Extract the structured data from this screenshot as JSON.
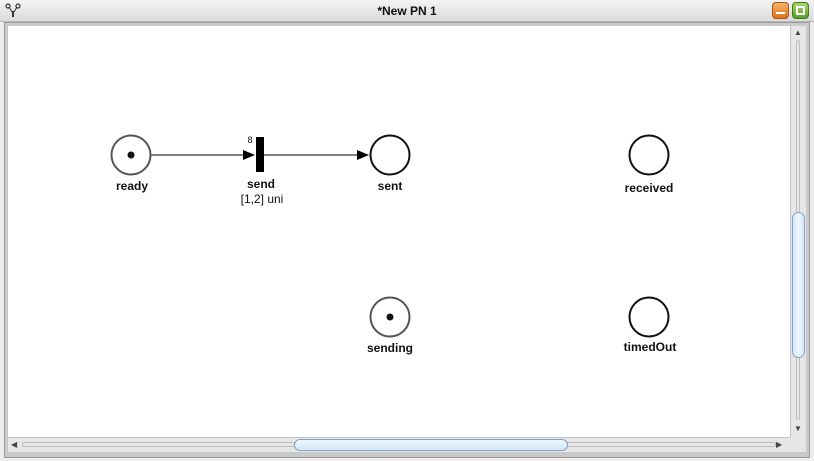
{
  "window": {
    "title": "*New PN 1"
  },
  "net": {
    "places": [
      {
        "id": "ready",
        "label": "ready",
        "tokens": 1
      },
      {
        "id": "sent",
        "label": "sent",
        "tokens": 0
      },
      {
        "id": "received",
        "label": "received",
        "tokens": 0
      },
      {
        "id": "sending",
        "label": "sending",
        "tokens": 1
      },
      {
        "id": "timedOut",
        "label": "timedOut",
        "tokens": 0
      }
    ],
    "transitions": [
      {
        "id": "send",
        "label": "send",
        "timing": "[1,2] uni",
        "priority": "8"
      }
    ],
    "arcs": [
      {
        "from": "ready",
        "to": "send"
      },
      {
        "from": "send",
        "to": "sent"
      }
    ]
  },
  "colors": {
    "titlebar": "#dadada",
    "canvas": "#ffffff",
    "minimize_button": "#e98a2f",
    "maximize_button": "#6fb33a",
    "scroll_thumb": "#d3e6f7"
  },
  "icons": {
    "app": "petri-net-app-icon",
    "minimize": "minimize-icon",
    "maximize": "maximize-icon",
    "scroll_up": "arrow-up-icon",
    "scroll_down": "arrow-down-icon",
    "scroll_left": "arrow-left-icon",
    "scroll_right": "arrow-right-icon"
  }
}
